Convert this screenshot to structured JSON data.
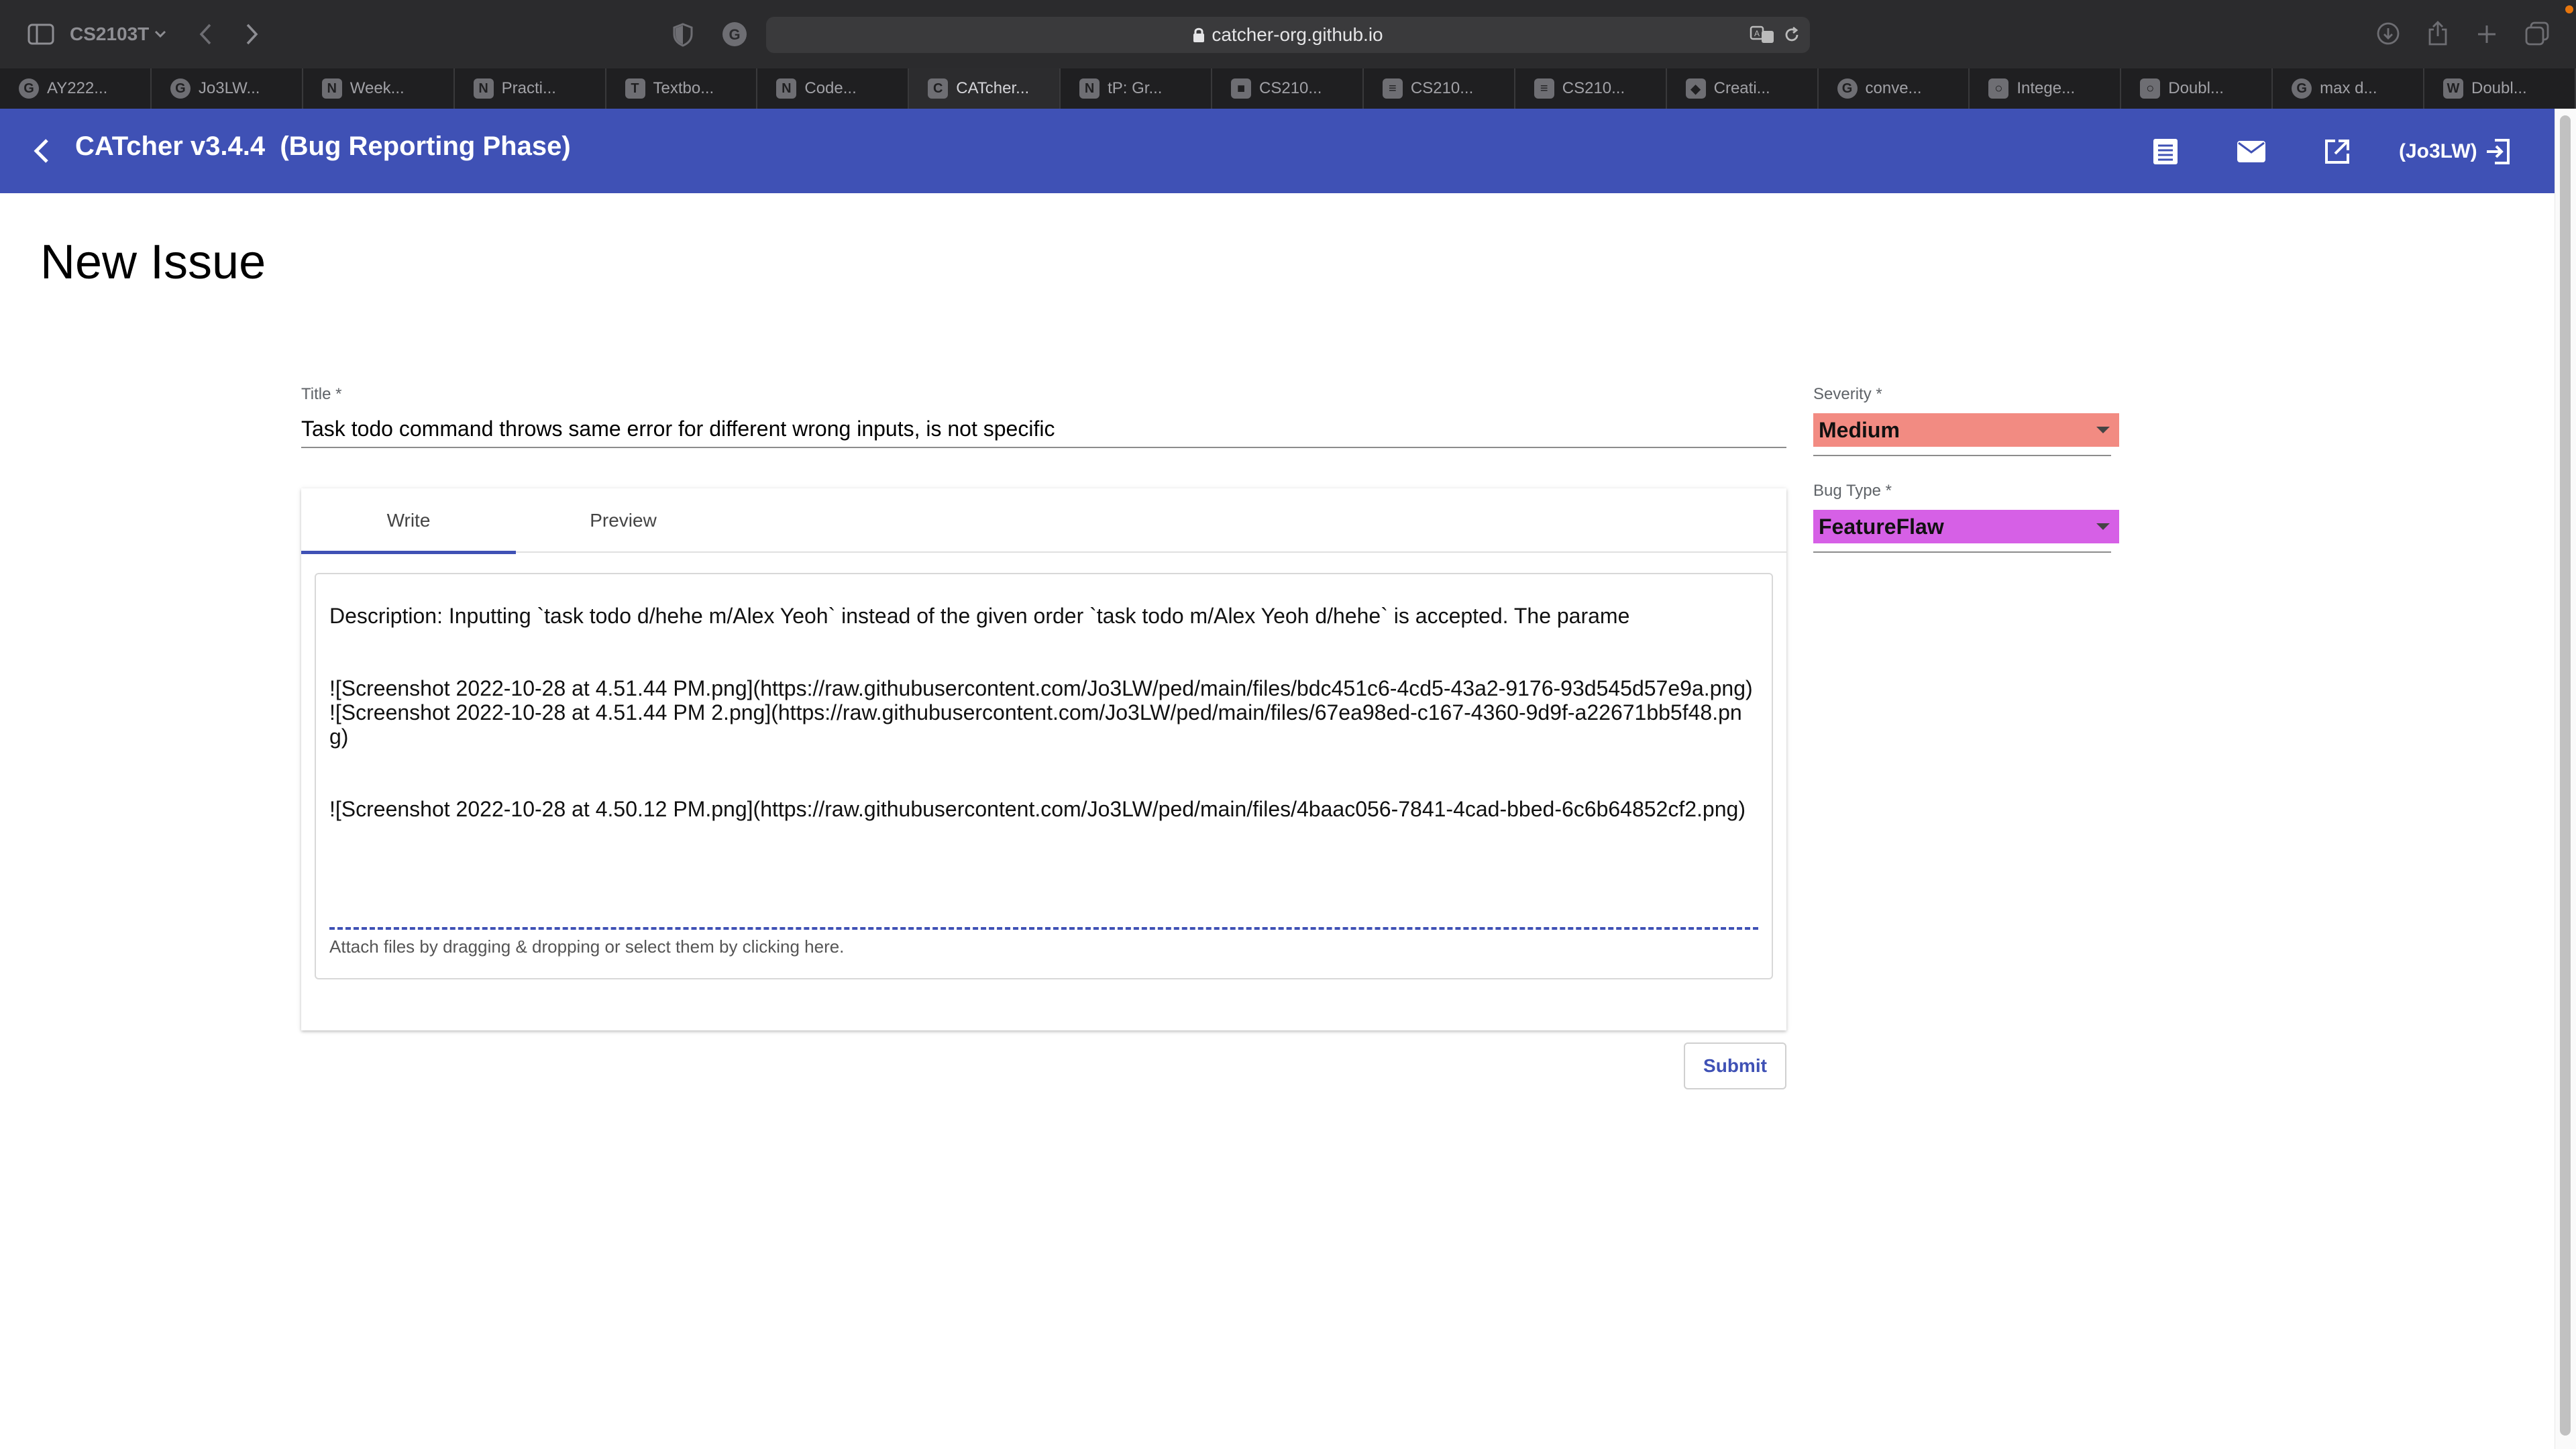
{
  "browser": {
    "tab_group": "CS2103T",
    "url": "catcher-org.github.io",
    "tabs": [
      {
        "label": "AY222...",
        "icon": "G"
      },
      {
        "label": "Jo3LW...",
        "icon": "G"
      },
      {
        "label": "Week...",
        "icon": "N"
      },
      {
        "label": "Practi...",
        "icon": "N"
      },
      {
        "label": "Textbo...",
        "icon": "T"
      },
      {
        "label": "Code...",
        "icon": "N"
      },
      {
        "label": "CATcher...",
        "icon": "C"
      },
      {
        "label": "tP: Gr...",
        "icon": "N"
      },
      {
        "label": "CS210...",
        "icon": "■"
      },
      {
        "label": "CS210...",
        "icon": "≡"
      },
      {
        "label": "CS210...",
        "icon": "≡"
      },
      {
        "label": "Creati...",
        "icon": "◆"
      },
      {
        "label": "conve...",
        "icon": "G"
      },
      {
        "label": "Intege...",
        "icon": "○"
      },
      {
        "label": "Doubl...",
        "icon": "○"
      },
      {
        "label": "max d...",
        "icon": "G"
      },
      {
        "label": "Doubl...",
        "icon": "W"
      }
    ],
    "active_tab_index": 6
  },
  "app": {
    "title": "CATcher v3.4.4  (Bug Reporting Phase)",
    "user": "(Jo3LW)",
    "accent_color": "#3f51b5"
  },
  "page": {
    "heading": "New Issue"
  },
  "form": {
    "title_label": "Title *",
    "title_value": "Task todo command throws same error for different wrong inputs, is not specific",
    "tabs": [
      "Write",
      "Preview"
    ],
    "active_tab": "Write",
    "description": "Description: Inputting `task todo d/hehe m/Alex Yeoh` instead of the given order `task todo m/Alex Yeoh d/hehe` is accepted. The parame\n\n\n![Screenshot 2022-10-28 at 4.51.44 PM.png](https://raw.githubusercontent.com/Jo3LW/ped/main/files/bdc451c6-4cd5-43a2-9176-93d545d57e9a.png)\n![Screenshot 2022-10-28 at 4.51.44 PM 2.png](https://raw.githubusercontent.com/Jo3LW/ped/main/files/67ea98ed-c167-4360-9d9f-a22671bb5f48.png)\n\n\n![Screenshot 2022-10-28 at 4.50.12 PM.png](https://raw.githubusercontent.com/Jo3LW/ped/main/files/4baac056-7841-4cad-bbed-6c6b64852cf2.png)",
    "attach_hint": "Attach files by dragging & dropping or select them by clicking here.",
    "submit_label": "Submit",
    "severity_label": "Severity *",
    "severity_value": "Medium",
    "severity_color": "#f28b82",
    "bug_type_label": "Bug Type *",
    "bug_type_value": "FeatureFlaw",
    "bug_type_color": "#d660e6"
  }
}
